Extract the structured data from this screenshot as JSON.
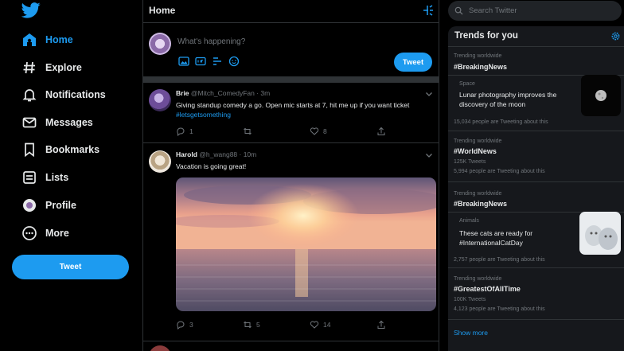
{
  "nav": {
    "items": [
      {
        "label": "Home",
        "icon": "home-icon"
      },
      {
        "label": "Explore",
        "icon": "hashtag-icon"
      },
      {
        "label": "Notifications",
        "icon": "bell-icon"
      },
      {
        "label": "Messages",
        "icon": "envelope-icon"
      },
      {
        "label": "Bookmarks",
        "icon": "bookmark-icon"
      },
      {
        "label": "Lists",
        "icon": "list-icon"
      },
      {
        "label": "Profile",
        "icon": "profile-icon"
      },
      {
        "label": "More",
        "icon": "more-icon"
      }
    ],
    "tweet_button": "Tweet"
  },
  "header": {
    "title": "Home"
  },
  "composer": {
    "placeholder": "What's happening?",
    "tweet_button": "Tweet"
  },
  "feed": [
    {
      "name": "Brie",
      "handle": "@Mitch_ComedyFan · 3m",
      "text": "Giving standup comedy a go. Open mic starts at 7, hit me up if you want ticket",
      "link": "#letsgetsomething",
      "replies": "1",
      "retweets": "",
      "likes": "8"
    },
    {
      "name": "Harold",
      "handle": "@h_wang88 · 10m",
      "text": "Vacation is going great!",
      "replies": "3",
      "retweets": "5",
      "likes": "14"
    }
  ],
  "search": {
    "placeholder": "Search Twitter"
  },
  "trends": {
    "title": "Trends for you",
    "items": [
      {
        "context": "Trending worldwide",
        "tag": "#BreakingNews"
      },
      {
        "context": "Space",
        "text": "Lunar photography improves the discovery of the moon",
        "meta": "15,034 people are Tweeting about this"
      },
      {
        "context": "Trending worldwide",
        "tag": "#WorldNews",
        "count": "125K Tweets",
        "meta": "5,994 people are Tweeting about this"
      },
      {
        "context": "Trending worldwide",
        "tag": "#BreakingNews"
      },
      {
        "context": "Animals",
        "text": "These cats are ready for #InternationalCatDay",
        "meta": "2,757 people are Tweeting about this"
      },
      {
        "context": "Trending worldwide",
        "tag": "#GreatestOfAllTime",
        "count": "100K Tweets",
        "meta": "4,123 people are Tweeting about this"
      }
    ],
    "show_more": "Show more"
  },
  "colors": {
    "accent": "#1d9bf0",
    "background": "#000000",
    "panel": "#16181c",
    "muted": "#71767b"
  }
}
